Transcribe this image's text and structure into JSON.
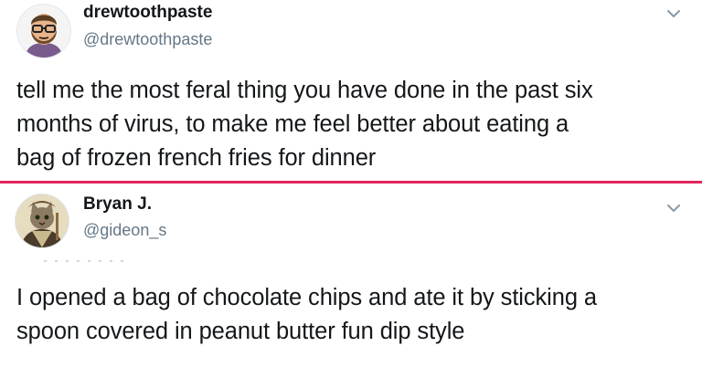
{
  "tweets": [
    {
      "display_name": "drewtoothpaste",
      "handle": "@drewtoothpaste",
      "text": "tell me the most feral thing you have done in the past six\nmonths of virus, to make me feel better about eating a\nbag of frozen french fries for dinner",
      "avatar_icon": "bearded-man-with-glasses-avatar",
      "menu_icon": "chevron-down-icon"
    },
    {
      "display_name": "Bryan J.",
      "handle": "@gideon_s",
      "text": "I opened a bag of chocolate chips and ate it by sticking a\nspoon covered in peanut butter fun dip style",
      "avatar_icon": "cat-in-costume-avatar",
      "menu_icon": "chevron-down-icon"
    }
  ],
  "colors": {
    "divider": "#e0245e",
    "handle": "#657786",
    "text": "#14171a"
  }
}
